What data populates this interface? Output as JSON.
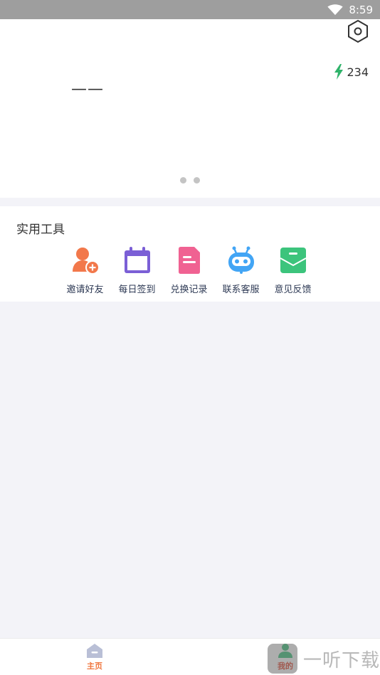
{
  "status_bar": {
    "time": "8:59"
  },
  "header": {
    "username": "——",
    "energy_count": "234",
    "colors": {
      "energy": "#2fb36a"
    }
  },
  "tools": {
    "title": "实用工具",
    "items": [
      {
        "label": "邀请好友",
        "icon": "invite-friend-icon",
        "color": "#f2784b"
      },
      {
        "label": "每日签到",
        "icon": "calendar-icon",
        "color": "#7b5fd6"
      },
      {
        "label": "兑换记录",
        "icon": "document-icon",
        "color": "#f06292"
      },
      {
        "label": "联系客服",
        "icon": "robot-icon",
        "color": "#42a5f5"
      },
      {
        "label": "意见反馈",
        "icon": "mail-icon",
        "color": "#3cc47c"
      }
    ]
  },
  "bottom_nav": {
    "home": "主页",
    "mine": "我的"
  },
  "watermark": {
    "text": "一听下载"
  }
}
